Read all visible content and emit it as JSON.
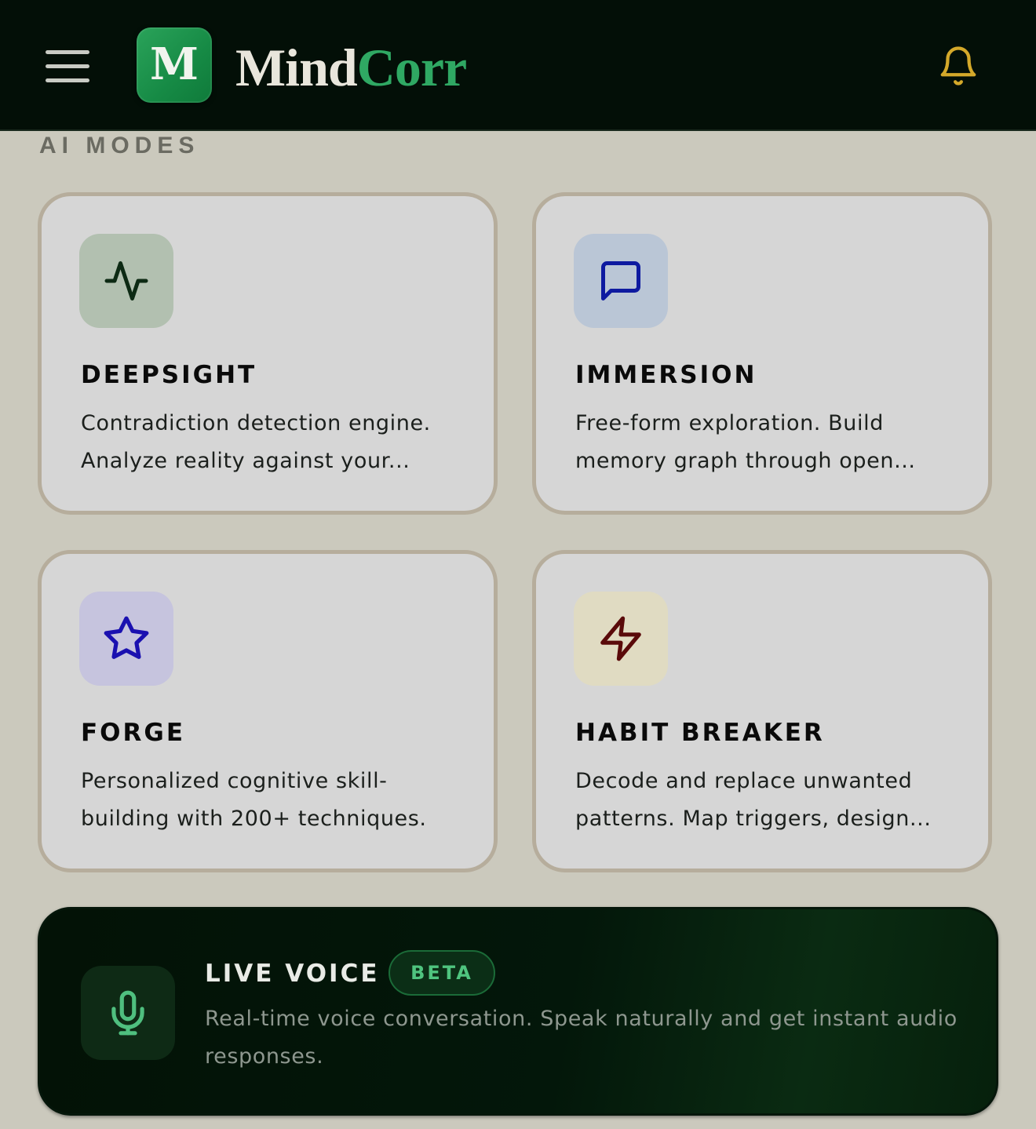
{
  "header": {
    "menu_icon": "hamburger-menu-icon",
    "logo_letter": "M",
    "brand_part1": "Mind",
    "brand_part2": "Corr",
    "bell_icon": "bell-icon",
    "colors": {
      "background": "#030f07",
      "brand_accent": "#2fa863",
      "bell": "#d4a92a"
    }
  },
  "section": {
    "label": "AI MODES"
  },
  "modes": [
    {
      "title": "DEEPSIGHT",
      "description_line1": "Contradiction detection engine.",
      "description_line2": "Analyze reality against your...",
      "icon": "activity-pulse-icon",
      "tile_color": "#b2c0b0",
      "icon_color": "#0d2a14"
    },
    {
      "title": "IMMERSION",
      "description_line1": "Free-form exploration. Build",
      "description_line2": "memory graph through open...",
      "icon": "message-square-icon",
      "tile_color": "#bac6d6",
      "icon_color": "#0e1aa0"
    },
    {
      "title": "FORGE",
      "description_line1": "Personalized cognitive skill-",
      "description_line2": "building with 200+ techniques.",
      "icon": "star-icon",
      "tile_color": "#c6c4de",
      "icon_color": "#1a10b0"
    },
    {
      "title": "HABIT BREAKER",
      "description_line1": "Decode and replace unwanted",
      "description_line2": "patterns. Map triggers, design...",
      "icon": "lightning-bolt-icon",
      "tile_color": "#e0dbc2",
      "icon_color": "#5a0a0a"
    }
  ],
  "live_voice": {
    "title": "LIVE VOICE",
    "badge": "BETA",
    "description": "Real-time voice conversation. Speak naturally and get instant audio responses.",
    "icon": "microphone-icon",
    "icon_color": "#4fbf7f"
  }
}
